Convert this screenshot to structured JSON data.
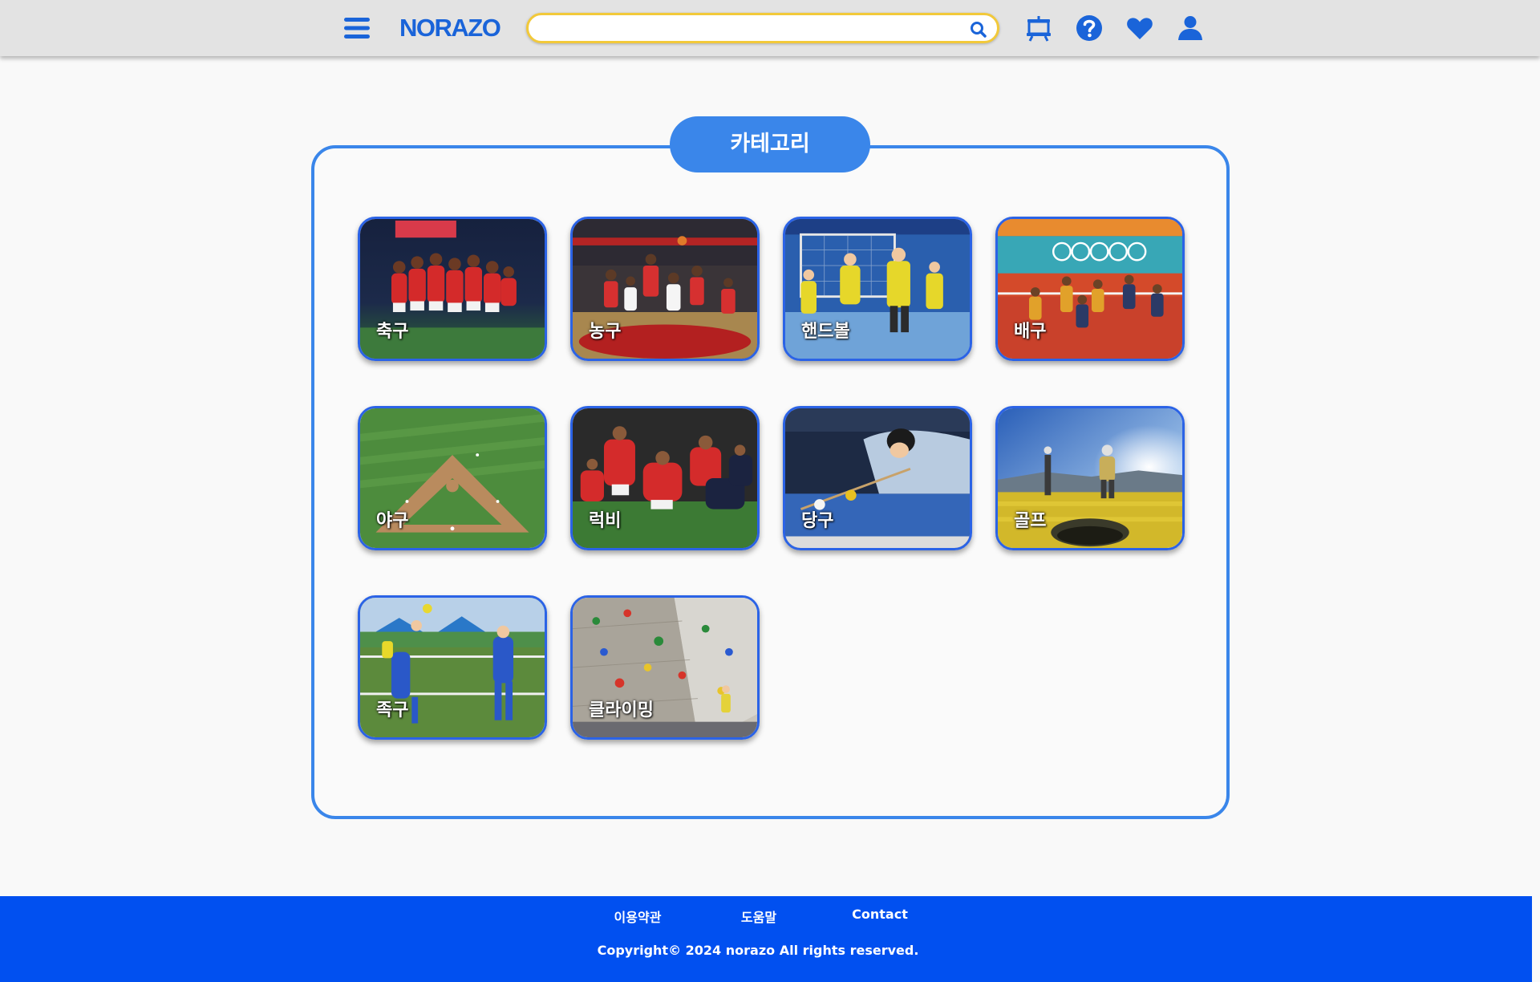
{
  "header": {
    "logo": "NORAZO",
    "search": {
      "value": "",
      "placeholder": ""
    },
    "icons": [
      "menu-icon",
      "search-icon",
      "easel-icon",
      "help-icon",
      "heart-icon",
      "user-icon"
    ]
  },
  "main": {
    "title": "카테고리",
    "categories": [
      {
        "label": "축구",
        "scene": "soccer"
      },
      {
        "label": "농구",
        "scene": "basketball"
      },
      {
        "label": "핸드볼",
        "scene": "handball"
      },
      {
        "label": "배구",
        "scene": "volleyball"
      },
      {
        "label": "야구",
        "scene": "baseball"
      },
      {
        "label": "럭비",
        "scene": "rugby"
      },
      {
        "label": "당구",
        "scene": "billiards"
      },
      {
        "label": "골프",
        "scene": "golf"
      },
      {
        "label": "족구",
        "scene": "jokgu"
      },
      {
        "label": "클라이밍",
        "scene": "climbing"
      }
    ]
  },
  "footer": {
    "links": [
      "이용약관",
      "도움말",
      "Contact"
    ],
    "copyright": "Copyright© 2024 norazo All rights reserved."
  },
  "colors": {
    "accent": "#3a86ea",
    "footer": "#0150f0",
    "icon": "#1a64d9",
    "search_border": "#f2c93a",
    "card_border": "#2b63e6"
  }
}
